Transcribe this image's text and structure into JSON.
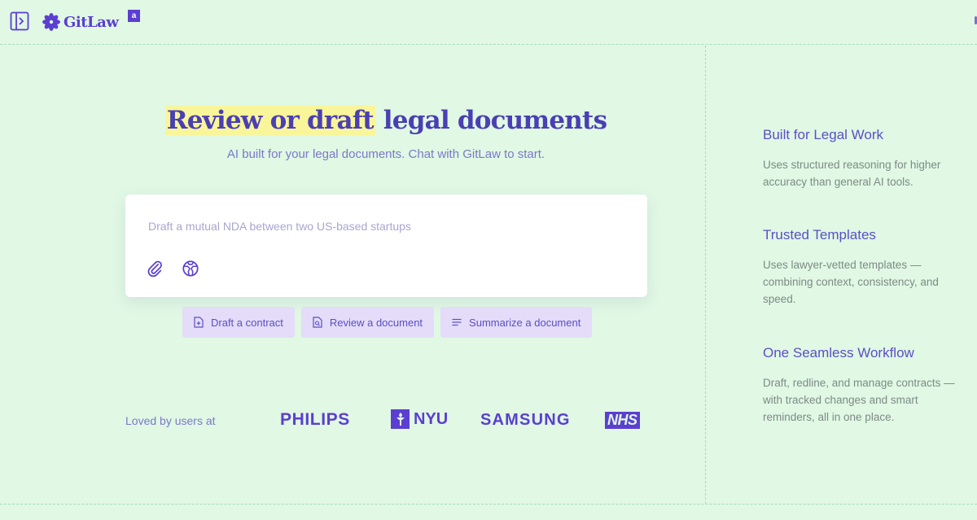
{
  "header": {
    "logo_text": "GitLaw",
    "badge": "a"
  },
  "hero": {
    "headline_highlight": "Review or draft",
    "headline_rest": " legal documents",
    "subheadline": "AI built for your legal documents. Chat with GitLaw to start."
  },
  "prompt": {
    "placeholder": "Draft a mutual NDA between two US-based startups",
    "value": ""
  },
  "chips": [
    {
      "label": "Draft a contract",
      "icon": "file-plus-icon"
    },
    {
      "label": "Review a document",
      "icon": "file-search-icon"
    },
    {
      "label": "Summarize a document",
      "icon": "lines-icon"
    }
  ],
  "logos": {
    "intro": "Loved by users at",
    "philips": "PHILIPS",
    "nyu": "NYU",
    "samsung": "SAMSUNG",
    "nhs": "NHS"
  },
  "features": [
    {
      "title": "Built for Legal Work",
      "description": "Uses structured reasoning for higher accuracy than general AI tools."
    },
    {
      "title": "Trusted Templates",
      "description": "Uses lawyer-vetted templates — combining context, consistency, and speed."
    },
    {
      "title": "One Seamless Workflow",
      "description": "Draft, redline, and manage contracts — with tracked changes and smart reminders, all in one place."
    }
  ],
  "colors": {
    "background": "#e0f8e4",
    "accent": "#5b3fd0",
    "highlight": "#f9f59a",
    "chip": "#e4dcf8"
  }
}
